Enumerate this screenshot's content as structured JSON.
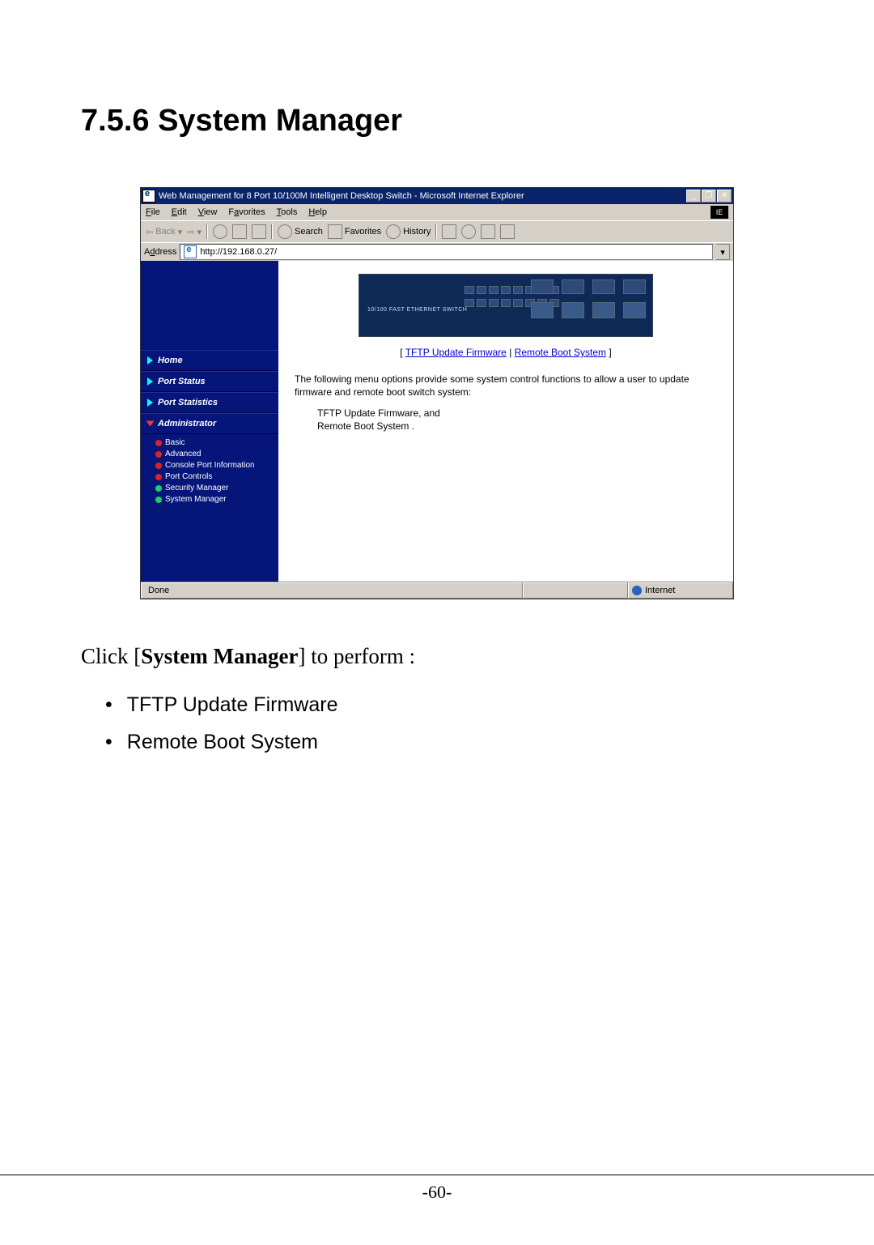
{
  "doc": {
    "heading": "7.5.6 System Manager",
    "lead_prefix": "Click [",
    "lead_bold": "System Manager",
    "lead_suffix": "] to perform :",
    "bullet1": "TFTP Update Firmware",
    "bullet2": "Remote Boot System",
    "page_number": "-60-"
  },
  "win": {
    "title": "Web Management for 8 Port 10/100M Intelligent Desktop Switch - Microsoft Internet Explorer",
    "btn_min": "_",
    "btn_max": "❐",
    "btn_close": "✕"
  },
  "menu": {
    "file": "File",
    "file_u": "F",
    "edit": "Edit",
    "edit_u": "E",
    "view": "View",
    "view_u": "V",
    "fav": "Favorites",
    "fav_u": "a",
    "tools": "Tools",
    "tools_u": "T",
    "help": "Help",
    "help_u": "H"
  },
  "toolbar": {
    "back": "Back",
    "search": "Search",
    "favorites": "Favorites",
    "history": "History"
  },
  "addr": {
    "label": "Address",
    "label_u": "d",
    "value": "http://192.168.0.27/",
    "dd": "▾"
  },
  "sidebar": {
    "home": "Home",
    "port_status": "Port Status",
    "port_stats": "Port Statistics",
    "admin": "Administrator",
    "sub": {
      "basic": "Basic",
      "advanced": "Advanced",
      "console": "Console Port Information",
      "portctrl": "Port Controls",
      "secmgr": "Security Manager",
      "sysmgr": "System Manager"
    }
  },
  "device": {
    "label": "10/100 FAST ETHERNET SWITCH"
  },
  "main": {
    "link1": "TFTP Update Firmware",
    "sep": " | ",
    "link2": "Remote Boot System",
    "lb": "[ ",
    "rb": " ]",
    "desc": "The following menu options provide some system control functions to allow a user to update firmware and remote boot switch system:",
    "item1": "TFTP Update Firmware, and",
    "item2": "Remote Boot System ."
  },
  "status": {
    "done": "Done",
    "zone": "Internet"
  }
}
